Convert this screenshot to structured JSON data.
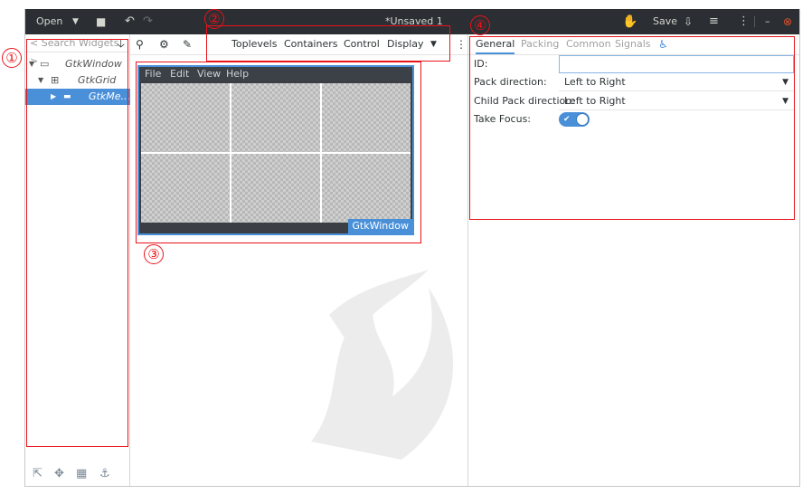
{
  "header": {
    "open_label": "Open",
    "title": "*Unsaved 1",
    "save_label": "Save",
    "icons": [
      "open-dropdown-icon",
      "new-file-icon",
      "undo-icon",
      "redo-icon",
      "glade-logo-icon",
      "export-icon",
      "hamburger-menu-icon",
      "more-options-icon",
      "minimize-icon",
      "close-icon"
    ]
  },
  "widget_tree": {
    "search_placeholder": "< Search Widgets >",
    "items": [
      {
        "label": "GtkWindow",
        "icon": "window-icon",
        "depth": 0
      },
      {
        "label": "GtkGrid",
        "icon": "grid-icon",
        "depth": 1
      },
      {
        "label": "GtkMe...",
        "icon": "menubar-icon",
        "depth": 2,
        "selected": true
      }
    ],
    "tools": [
      "pointer-icon",
      "drag-resize-icon",
      "margin-edit-icon",
      "align-edit-icon"
    ]
  },
  "palette": {
    "tabs": [
      "Toplevels",
      "Containers",
      "Control",
      "Display"
    ]
  },
  "design": {
    "menus": [
      "File",
      "Edit",
      "View",
      "Help"
    ],
    "window_label": "GtkWindow"
  },
  "inspector": {
    "tabs": [
      "General",
      "Packing",
      "Common",
      "Signals"
    ],
    "props": {
      "id_label": "ID:",
      "id_value": "",
      "pack_dir_label": "Pack direction:",
      "pack_dir_value": "Left to Right",
      "child_pack_dir_label": "Child Pack direction:",
      "child_pack_dir_value": "Left to Right",
      "take_focus_label": "Take Focus:",
      "take_focus_on": true
    }
  },
  "annotations": [
    "①",
    "②",
    "③",
    "④"
  ],
  "colors": {
    "headerbar": "#2b2e33",
    "selection": "#4a90d9",
    "annotation": "#e8141a"
  }
}
